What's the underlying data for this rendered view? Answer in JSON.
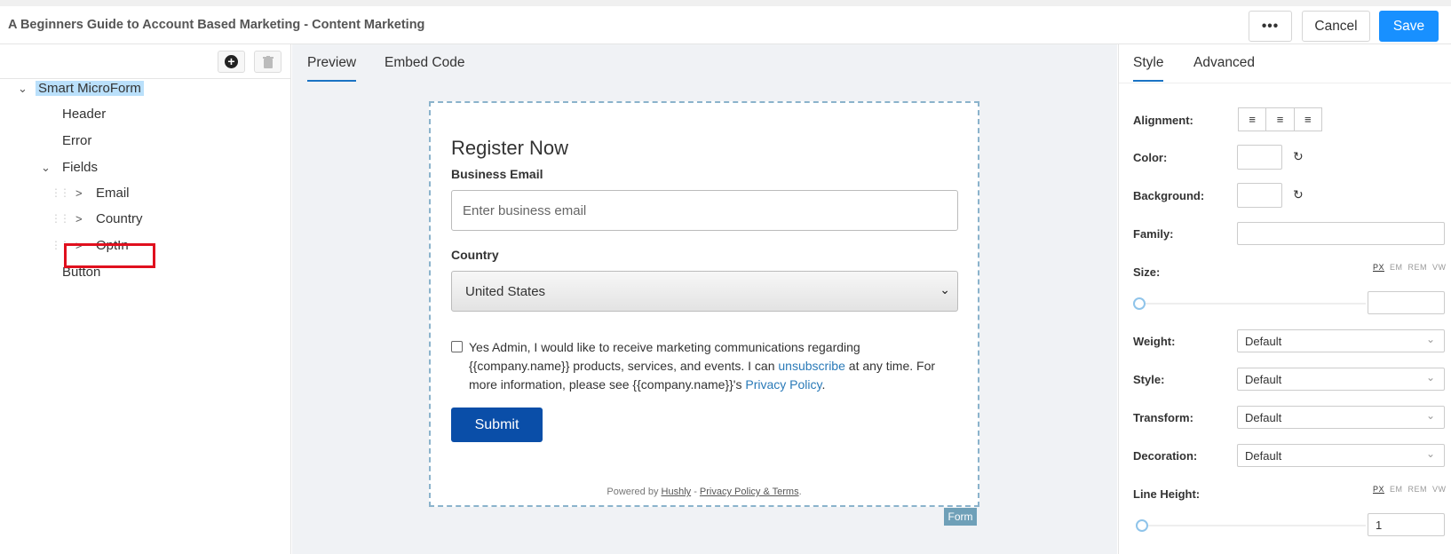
{
  "header": {
    "title": "A Beginners Guide to Account Based Marketing - Content Marketing",
    "more_label": "•••",
    "cancel_label": "Cancel",
    "save_label": "Save"
  },
  "tree": {
    "root": "Smart MicroForm",
    "header": "Header",
    "error": "Error",
    "fields": "Fields",
    "email": "Email",
    "country": "Country",
    "optin": "OptIn",
    "button": "Button"
  },
  "preview": {
    "tab_preview": "Preview",
    "tab_embed": "Embed Code",
    "form_title": "Register Now",
    "email_label": "Business Email",
    "email_placeholder": "Enter business email",
    "country_label": "Country",
    "country_value": "United States",
    "optin_text_1": "Yes Admin, I would like to receive marketing communications regarding {{company.name}} products, services, and events. I can ",
    "optin_link_unsub": "unsubscribe",
    "optin_text_2": " at any time. For more information, please see {{company.name}}'s ",
    "optin_link_privacy": "Privacy Policy",
    "optin_text_3": ".",
    "submit_label": "Submit",
    "powered_prefix": "Powered by ",
    "powered_brand": "Hushly",
    "powered_sep": " - ",
    "powered_terms": "Privacy Policy & Terms",
    "powered_suffix": ".",
    "form_tag": "Form"
  },
  "properties": {
    "tab_style": "Style",
    "tab_advanced": "Advanced",
    "alignment_label": "Alignment:",
    "color_label": "Color:",
    "background_label": "Background:",
    "family_label": "Family:",
    "size_label": "Size:",
    "weight_label": "Weight:",
    "weight_value": "Default",
    "style_label": "Style:",
    "style_value": "Default",
    "transform_label": "Transform:",
    "transform_value": "Default",
    "decoration_label": "Decoration:",
    "decoration_value": "Default",
    "line_height_label": "Line Height:",
    "line_height_value": "1",
    "units": [
      "PX",
      "EM",
      "REM",
      "VW"
    ]
  }
}
